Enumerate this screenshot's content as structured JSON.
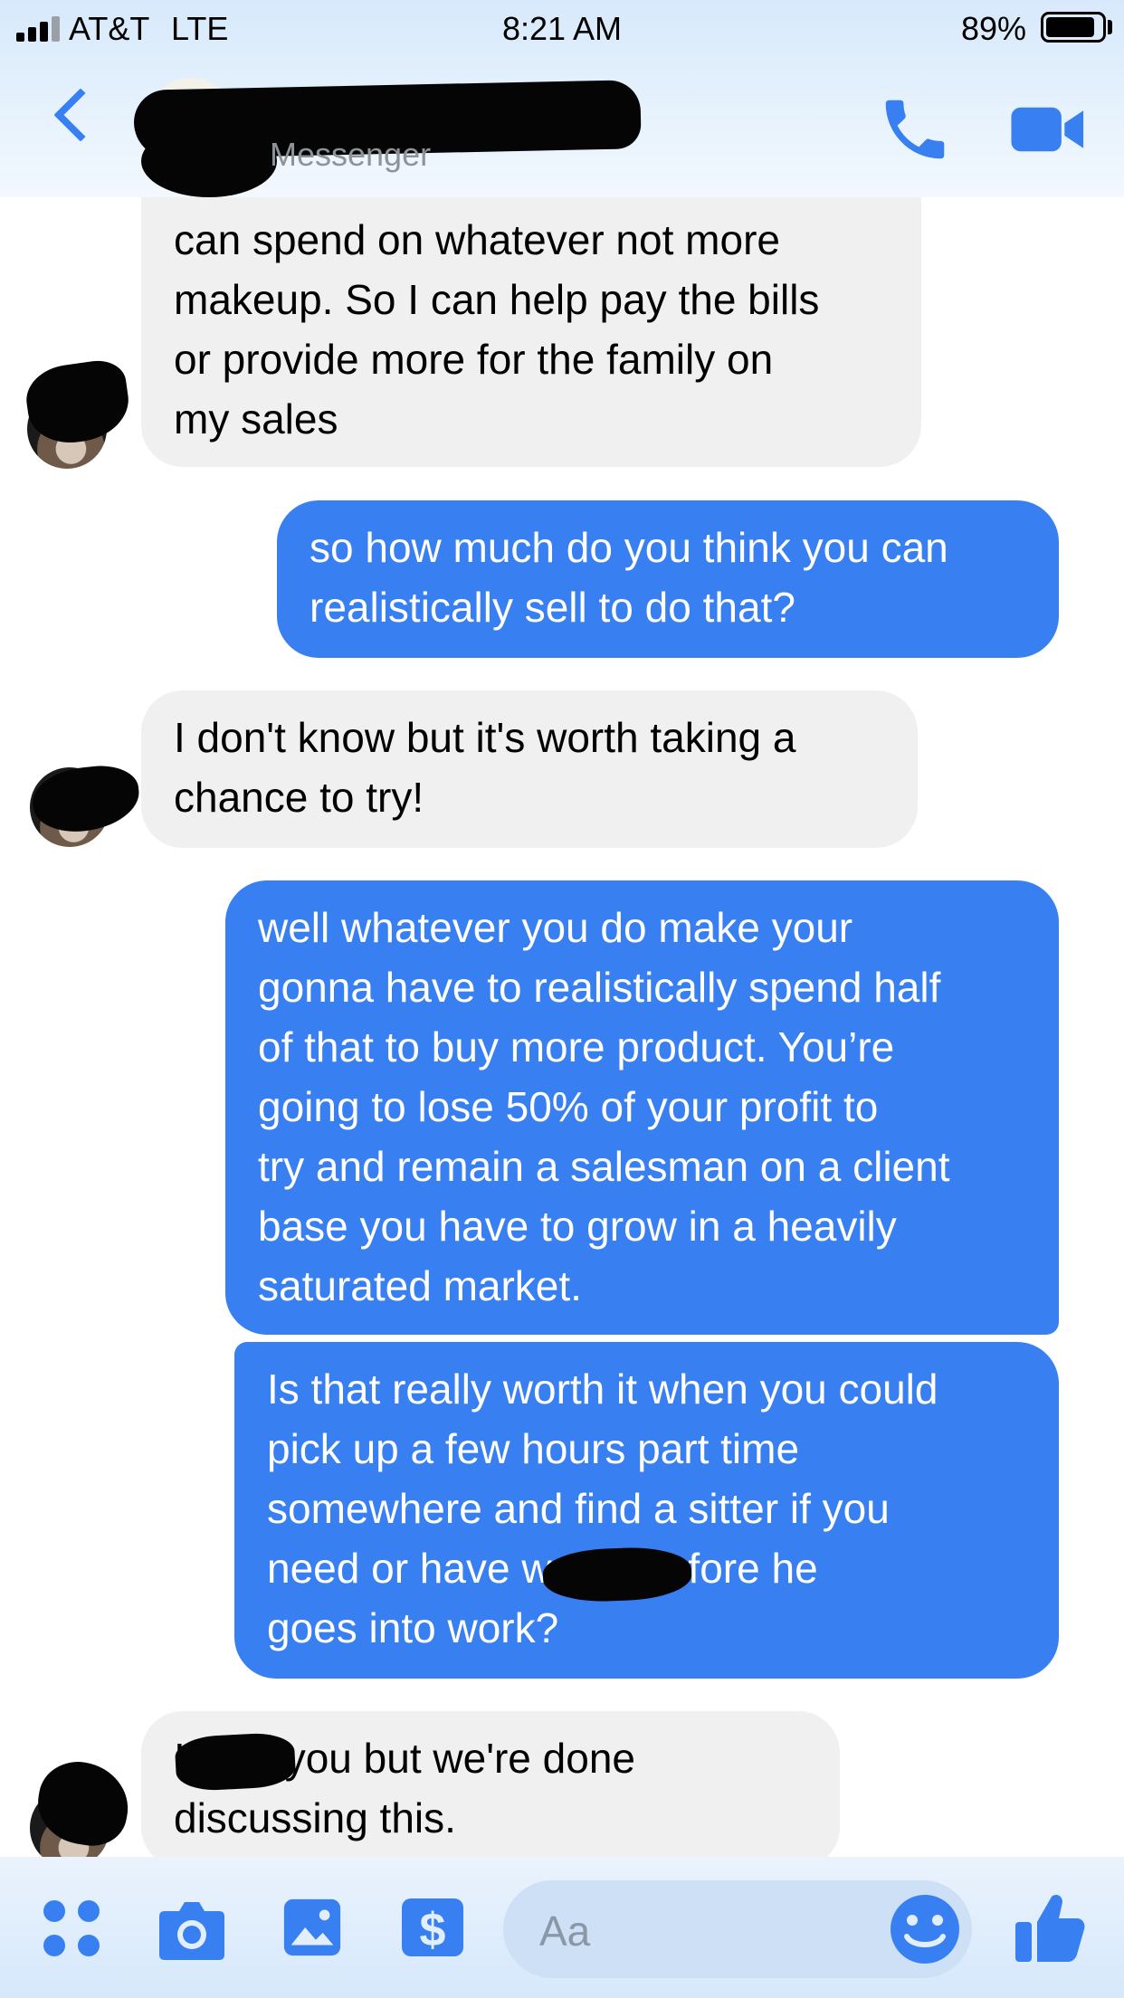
{
  "status_bar": {
    "carrier": "AT&T",
    "network": "LTE",
    "time": "8:21 AM",
    "battery_percent": "89%",
    "battery_level": 0.89
  },
  "header": {
    "subtitle": "Messenger",
    "back_icon": "chevron-left-icon",
    "call_icon": "phone-icon",
    "video_icon": "video-camera-icon",
    "accent_color": "#3880f2"
  },
  "messages": [
    {
      "direction": "incoming",
      "text": "can spend on whatever not more\nmakeup. So I can help pay the bills\nor provide more for the family on\nmy sales"
    },
    {
      "direction": "outgoing",
      "text": "so how much do you think you can\nrealistically sell to do that?"
    },
    {
      "direction": "incoming",
      "text": "I don't know but it's worth taking a\nchance to try!"
    },
    {
      "direction": "outgoing",
      "text": "well whatever you do make your\ngonna have to realistically spend half\nof that to buy more product. You’re\ngoing to lose 50% of your profit to\ntry and remain a salesman on a client\nbase you have to grow in a heavily\nsaturated market."
    },
    {
      "direction": "outgoing",
      "text": "Is that really worth it when you could\npick up a few hours part time\nsomewhere and find a sitter if you\nneed or have          watch before he\ngoes into work?"
    },
    {
      "direction": "incoming",
      "text": "         I love you but we're done\ndiscussing this."
    }
  ],
  "composer": {
    "placeholder": "Aa",
    "icons": [
      "apps-icon",
      "camera-icon",
      "gallery-icon",
      "payment-icon",
      "emoji-icon",
      "thumbs-up-icon"
    ]
  },
  "colors": {
    "outgoing_bubble": "#3880f2",
    "incoming_bubble": "#f1f0f0"
  }
}
